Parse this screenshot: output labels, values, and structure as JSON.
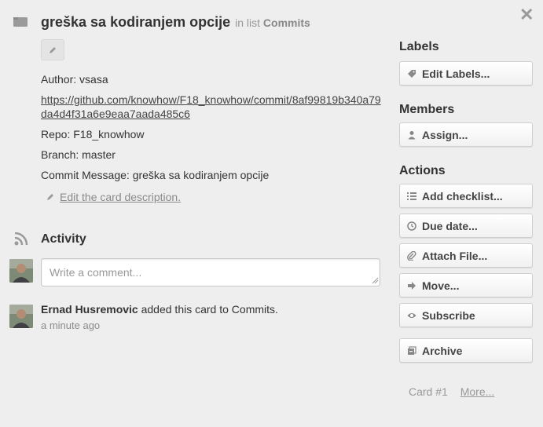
{
  "card": {
    "title": "greška sa kodiranjem opcije",
    "in_list_prefix": "in list",
    "list_name": "Commits"
  },
  "description": {
    "author": "Author: vsasa",
    "link": "https://github.com/knowhow/F18_knowhow/commit/8af99819b340a79da4d4f31a6e9eaa7aada485c6",
    "repo": "Repo: F18_knowhow",
    "branch": "Branch: master",
    "commit_message": "Commit Message: greška sa kodiranjem opcije",
    "edit_link": "Edit the card description."
  },
  "activity": {
    "heading": "Activity",
    "comment_placeholder": "Write a comment...",
    "entries": [
      {
        "user": "Ernad Husremovic",
        "action": "added this card to Commits.",
        "time": "a minute ago"
      }
    ]
  },
  "sidebar": {
    "labels_heading": "Labels",
    "edit_labels": "Edit Labels...",
    "members_heading": "Members",
    "assign": "Assign...",
    "actions_heading": "Actions",
    "actions": [
      {
        "label": "Add checklist...",
        "icon": "checklist-icon"
      },
      {
        "label": "Due date...",
        "icon": "clock-icon"
      },
      {
        "label": "Attach File...",
        "icon": "paperclip-icon"
      },
      {
        "label": "Move...",
        "icon": "arrow-right-icon"
      },
      {
        "label": "Subscribe",
        "icon": "eye-icon"
      },
      {
        "label": "Archive",
        "icon": "archive-icon"
      }
    ]
  },
  "footer": {
    "card_number": "Card #1",
    "more": "More..."
  }
}
